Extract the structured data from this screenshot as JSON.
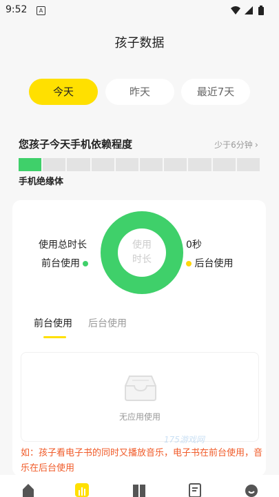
{
  "status_bar": {
    "time": "9:52",
    "notification_badge": "A"
  },
  "page": {
    "title": "孩子数据"
  },
  "tabs": [
    {
      "label": "今天",
      "active": true
    },
    {
      "label": "昨天",
      "active": false
    },
    {
      "label": "最近7天",
      "active": false
    }
  ],
  "dependency": {
    "title": "您孩子今天手机依赖程度",
    "hint": "少于6分钟",
    "level_label": "手机绝缘体",
    "segments_total": 10,
    "segments_filled": 1,
    "bar_color": "#3fd06a"
  },
  "usage": {
    "total_label": "使用总时长",
    "total_value": "0秒",
    "foreground_label": "前台使用",
    "background_label": "后台使用",
    "foreground_color": "#3fd06a",
    "background_color": "#ffd60a",
    "donut_center": "使用\n时长"
  },
  "sub_tabs": [
    {
      "label": "前台使用",
      "active": true
    },
    {
      "label": "后台使用",
      "active": false
    }
  ],
  "empty_state": {
    "text": "无应用使用",
    "icon": "empty-box-icon"
  },
  "note": "如：孩子看电子书的同时又播放音乐，电子书在前台使用，音乐在后台使用",
  "watermark": "175游戏网",
  "bottom_nav": [
    "home-icon",
    "data-icon",
    "book-icon",
    "notes-icon",
    "profile-icon"
  ],
  "colors": {
    "accent": "#ffe000",
    "green": "#3fd06a",
    "note": "#f05a28"
  }
}
